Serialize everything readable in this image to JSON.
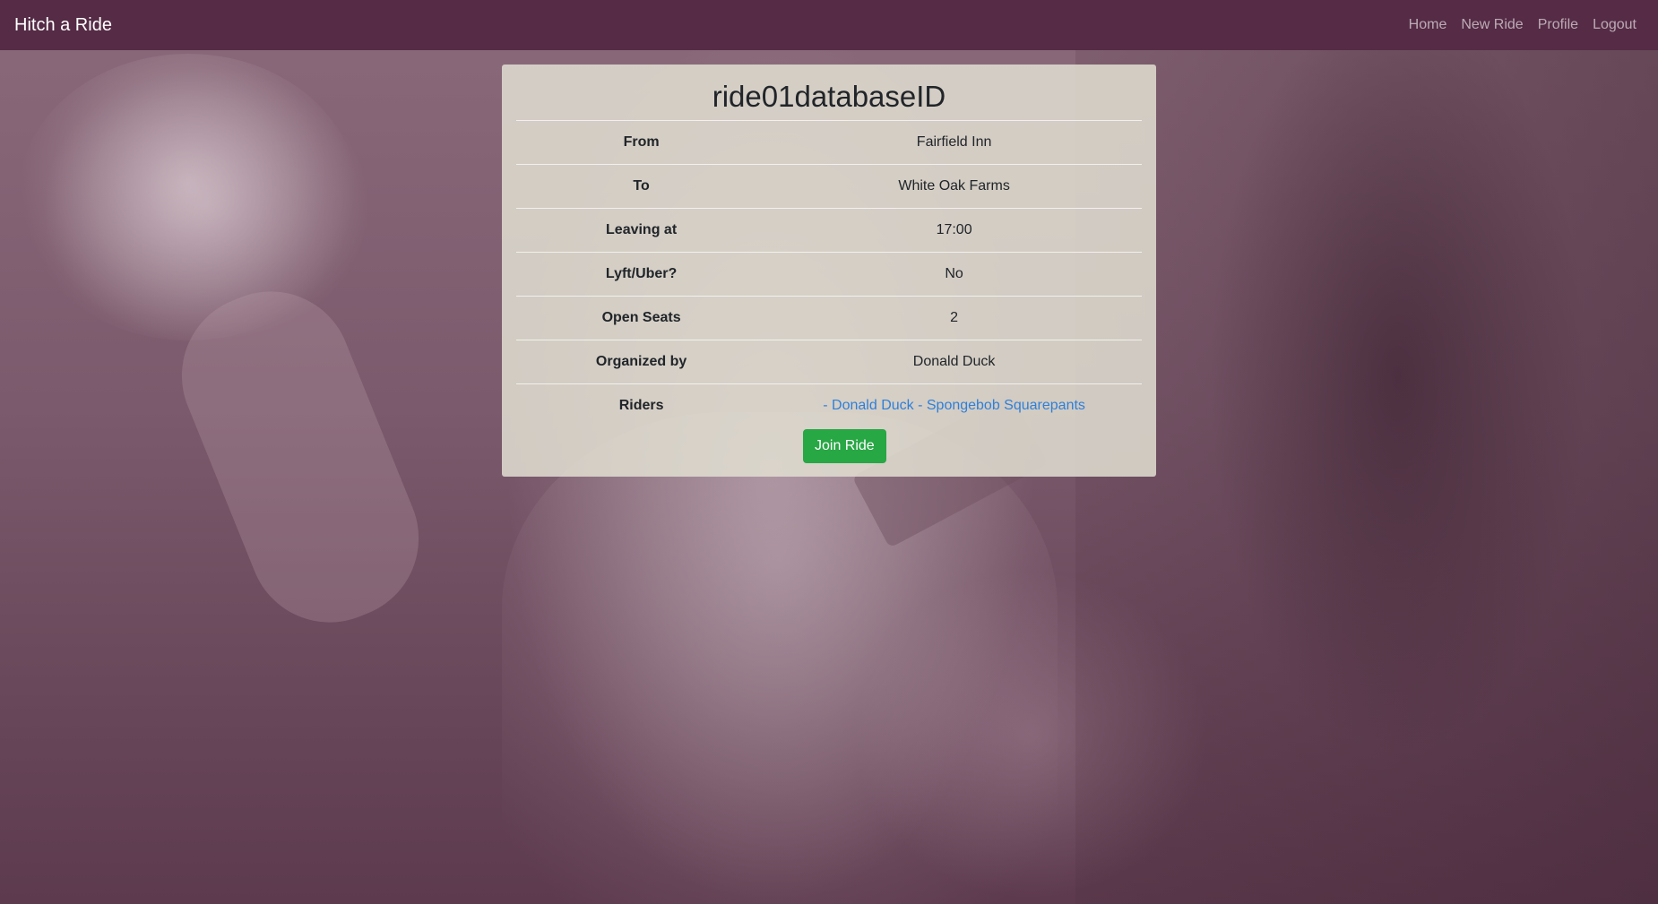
{
  "navbar": {
    "brand": "Hitch a Ride",
    "links": [
      {
        "label": "Home"
      },
      {
        "label": "New Ride"
      },
      {
        "label": "Profile"
      },
      {
        "label": "Logout"
      }
    ],
    "background_color": "#552b45"
  },
  "ride": {
    "title": "ride01databaseID",
    "rows": [
      {
        "label": "From",
        "value": "Fairfield Inn"
      },
      {
        "label": "To",
        "value": "White Oak Farms"
      },
      {
        "label": "Leaving at",
        "value": "17:00"
      },
      {
        "label": "Lyft/Uber?",
        "value": "No"
      },
      {
        "label": "Open Seats",
        "value": "2"
      },
      {
        "label": "Organized by",
        "value": "Donald Duck"
      }
    ],
    "riders_label": "Riders",
    "riders": [
      {
        "text": "- Donald Duck"
      },
      {
        "text": "- Spongebob Squarepants"
      }
    ],
    "join_button": "Join Ride"
  },
  "colors": {
    "join_button": "#28a745",
    "rider_link": "#2f7fd8"
  }
}
